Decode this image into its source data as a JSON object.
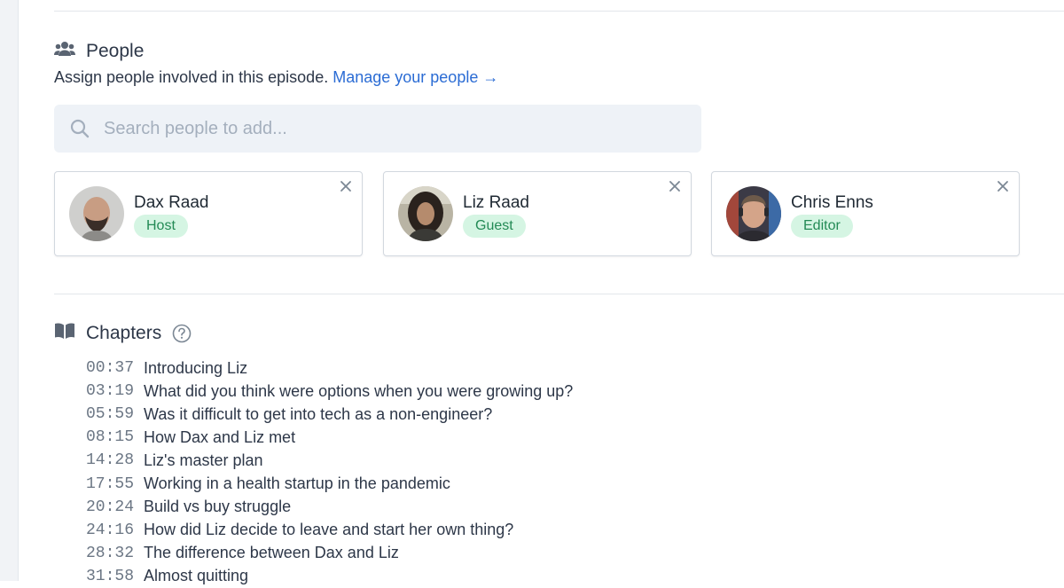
{
  "people": {
    "title": "People",
    "subtitle": "Assign people involved in this episode.",
    "manage_link": "Manage your people →",
    "search_placeholder": "Search people to add...",
    "cards": [
      {
        "name": "Dax Raad",
        "role": "Host"
      },
      {
        "name": "Liz Raad",
        "role": "Guest"
      },
      {
        "name": "Chris Enns",
        "role": "Editor"
      }
    ]
  },
  "chapters": {
    "title": "Chapters",
    "help_icon": "question-circle-icon",
    "items": [
      {
        "time": "00:37",
        "title": "Introducing Liz"
      },
      {
        "time": "03:19",
        "title": "What did you think were options when you were growing up?"
      },
      {
        "time": "05:59",
        "title": "Was it difficult to get into tech as a non-engineer?"
      },
      {
        "time": "08:15",
        "title": "How Dax and Liz met"
      },
      {
        "time": "14:28",
        "title": "Liz's master plan"
      },
      {
        "time": "17:55",
        "title": "Working in a health startup in the pandemic"
      },
      {
        "time": "20:24",
        "title": "Build vs buy struggle"
      },
      {
        "time": "24:16",
        "title": "How did Liz decide to leave and start her own thing?"
      },
      {
        "time": "28:32",
        "title": "The difference between Dax and Liz"
      },
      {
        "time": "31:58",
        "title": "Almost quitting"
      }
    ]
  },
  "colors": {
    "link": "#2b6cd4",
    "role_badge_bg": "#d5f5e3",
    "role_badge_text": "#238a55",
    "search_bg": "#eef2f7"
  }
}
